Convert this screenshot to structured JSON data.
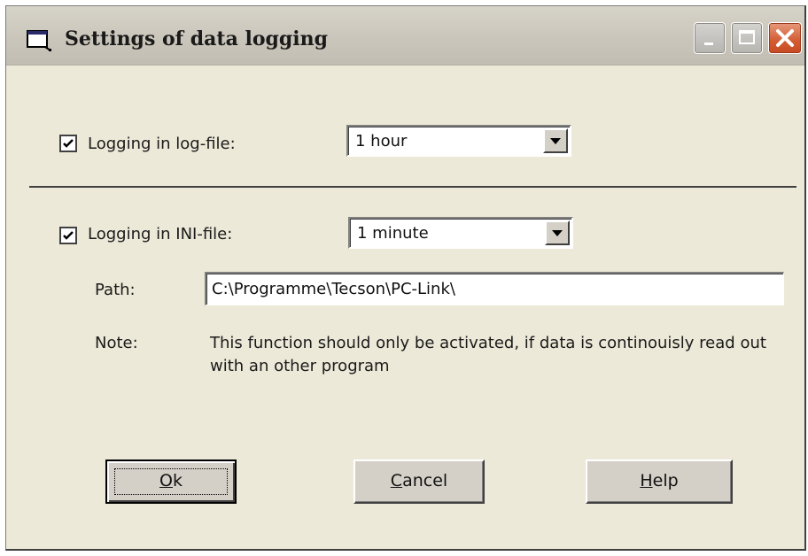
{
  "window": {
    "title": "Settings of data logging"
  },
  "logfile": {
    "checked": true,
    "label": "Logging in log-file:",
    "interval": "1 hour"
  },
  "inifile": {
    "checked": true,
    "label": "Logging in INI-file:",
    "interval": "1 minute"
  },
  "path": {
    "label": "Path:",
    "value": "C:\\Programme\\Tecson\\PC-Link\\"
  },
  "note": {
    "label": "Note:",
    "text": "This function should only be activated, if data is continouisly read out with an other program"
  },
  "buttons": {
    "ok": {
      "mnemonic": "O",
      "rest": "k"
    },
    "cancel": {
      "mnemonic": "C",
      "rest": "ancel"
    },
    "help": {
      "mnemonic": "H",
      "rest": "elp"
    }
  }
}
